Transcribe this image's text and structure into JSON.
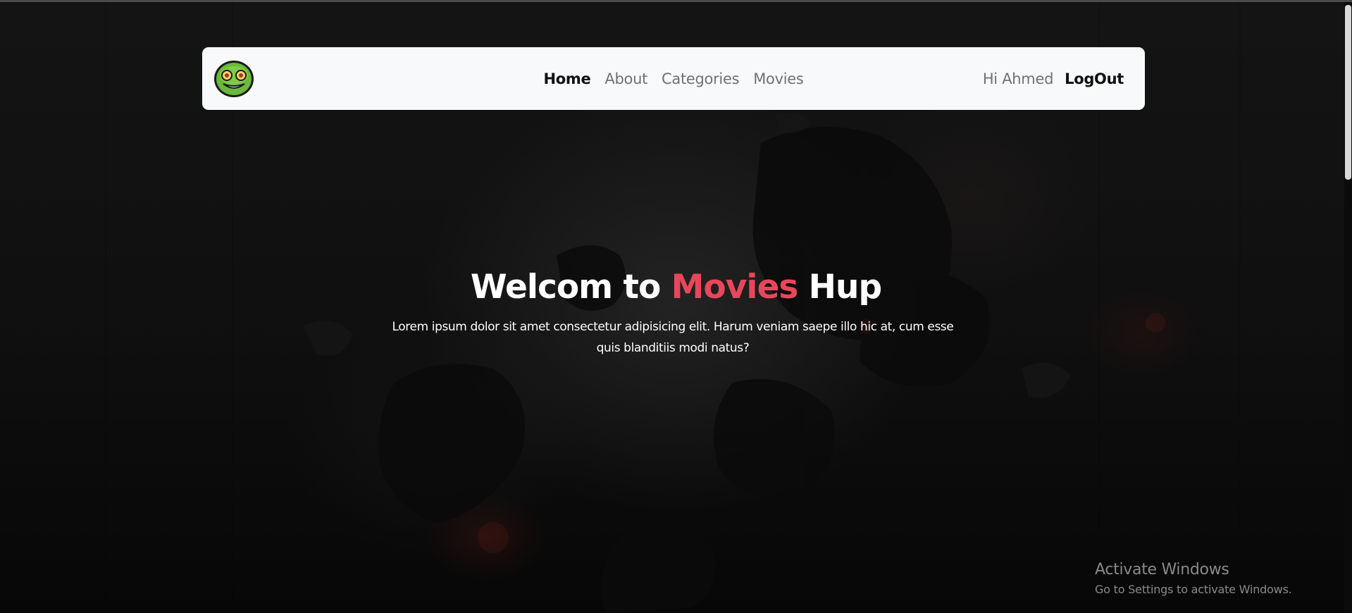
{
  "navbar": {
    "logo_icon": "smiley-face-logo-icon",
    "links": [
      {
        "label": "Home",
        "active": true
      },
      {
        "label": "About",
        "active": false
      },
      {
        "label": "Categories",
        "active": false
      },
      {
        "label": "Movies",
        "active": false
      }
    ],
    "greeting": "Hi Ahmed",
    "logout_label": "LogOut"
  },
  "hero": {
    "title_prefix": "Welcom to ",
    "title_accent": "Movies",
    "title_suffix": " Hup",
    "description": "Lorem ipsum dolor sit amet consectetur adipisicing elit. Harum veniam saepe illo hic at, cum esse quis blanditiis modi natus?"
  },
  "watermark": {
    "title": "Activate Windows",
    "subtitle": "Go to Settings to activate Windows."
  },
  "colors": {
    "accent": "#e8475b",
    "navbar_bg": "#f8f9fa",
    "nav_active": "#111111",
    "nav_inactive": "#717171",
    "page_bg": "#0a0a0a"
  }
}
